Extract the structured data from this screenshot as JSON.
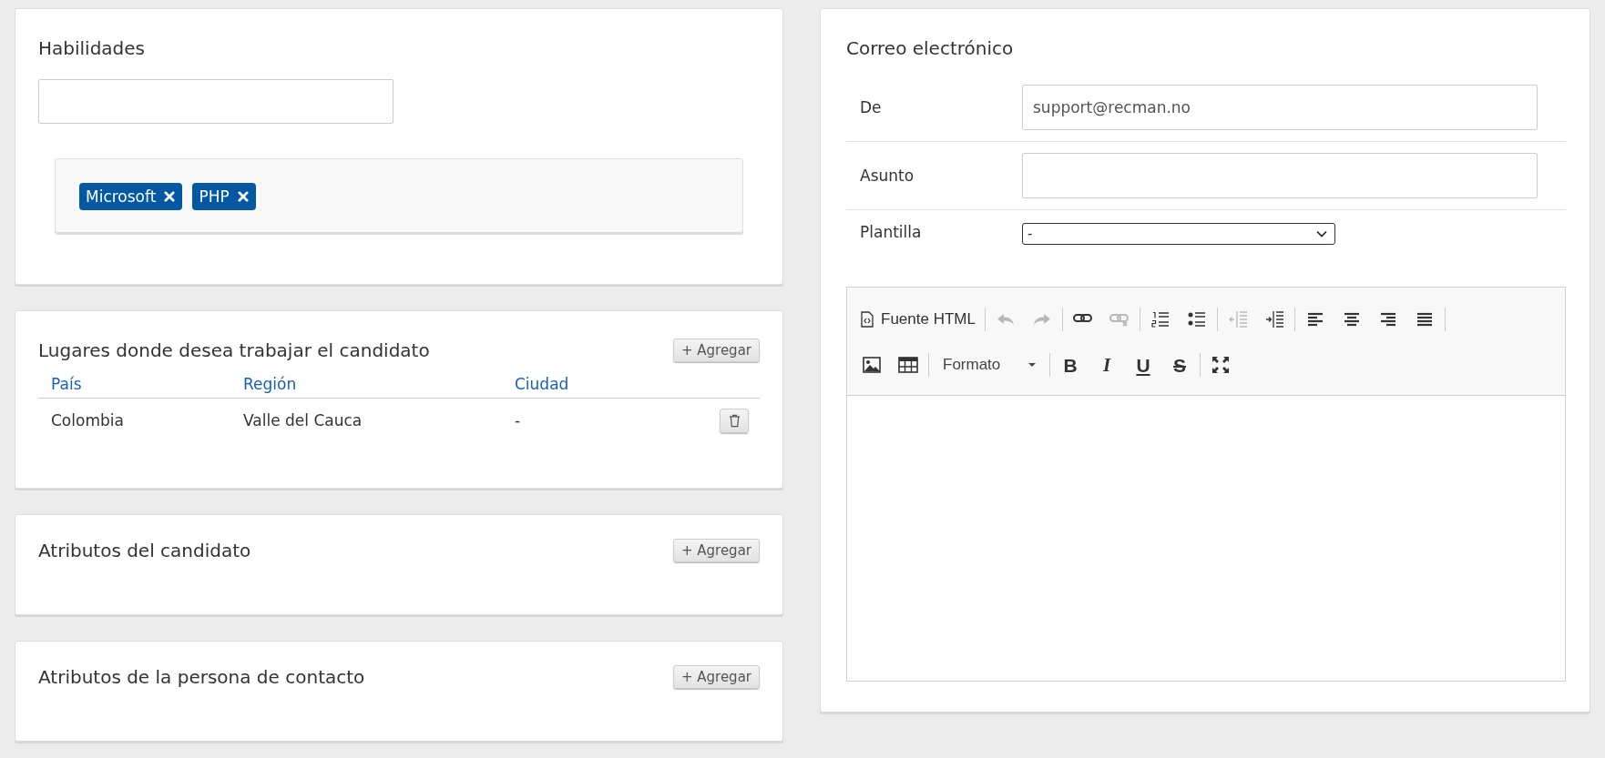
{
  "skills": {
    "title": "Habilidades",
    "tags": [
      {
        "label": "Microsoft"
      },
      {
        "label": "PHP"
      }
    ]
  },
  "locations": {
    "title": "Lugares donde desea trabajar el candidato",
    "add_button": "+ Agregar",
    "columns": [
      "País",
      "Región",
      "Ciudad"
    ],
    "rows": [
      {
        "cells": [
          "Colombia",
          "Valle del Cauca",
          "-"
        ]
      }
    ]
  },
  "candidate_attributes": {
    "title": "Atributos del candidato",
    "add_button": "+ Agregar"
  },
  "contact_attributes": {
    "title": "Atributos de la persona de contacto",
    "add_button": "+ Agregar"
  },
  "email": {
    "title": "Correo electrónico",
    "fields": [
      {
        "kind": "text",
        "label": "De",
        "value": "support@recman.no"
      },
      {
        "kind": "text",
        "label": "Asunto"
      },
      {
        "kind": "select",
        "label": "Plantilla",
        "value": "-"
      }
    ],
    "toolbar": [
      [
        [
          {
            "kind": "source",
            "label": "Fuente HTML",
            "disabled": false
          }
        ],
        [
          {
            "kind": "undo",
            "disabled": true
          },
          {
            "kind": "redo",
            "disabled": true
          }
        ],
        [
          {
            "kind": "link",
            "disabled": false
          },
          {
            "kind": "unlink",
            "disabled": true
          }
        ],
        [
          {
            "kind": "ol",
            "disabled": false
          },
          {
            "kind": "ul",
            "disabled": false
          }
        ],
        [
          {
            "kind": "outdent",
            "disabled": true
          },
          {
            "kind": "indent",
            "disabled": false
          }
        ],
        [
          {
            "kind": "left",
            "disabled": false
          },
          {
            "kind": "center",
            "disabled": false
          },
          {
            "kind": "right",
            "disabled": false
          },
          {
            "kind": "justify",
            "disabled": false
          }
        ]
      ],
      [
        [
          {
            "kind": "image",
            "disabled": false
          },
          {
            "kind": "table",
            "disabled": false
          }
        ],
        [
          {
            "kind": "format",
            "label": "Formato",
            "disabled": false
          }
        ],
        [
          {
            "kind": "bold",
            "label": "B",
            "disabled": false
          },
          {
            "kind": "italic",
            "label": "I",
            "disabled": false
          },
          {
            "kind": "underline",
            "label": "U",
            "disabled": false
          },
          {
            "kind": "strike",
            "label": "S",
            "disabled": false
          }
        ],
        [
          {
            "kind": "maximize",
            "disabled": false
          }
        ]
      ]
    ]
  }
}
